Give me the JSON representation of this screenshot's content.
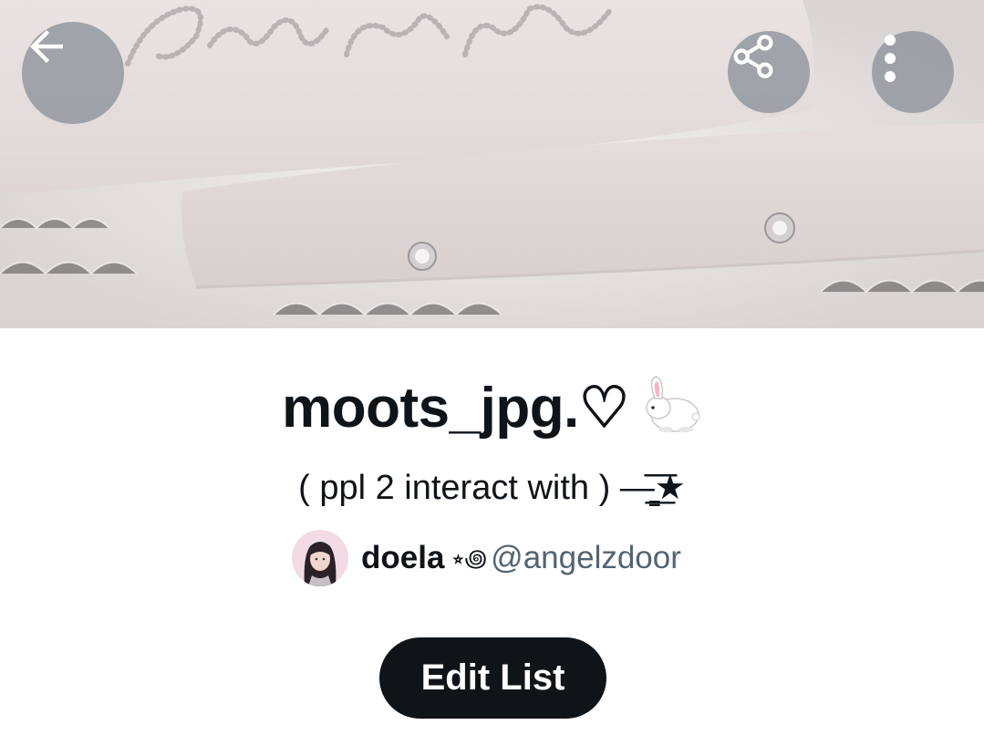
{
  "header": {
    "back_icon": "arrow-left-icon",
    "share_icon": "share-icon",
    "more_icon": "more-vertical-icon"
  },
  "list": {
    "title": "moots_jpg.♡",
    "title_emoji": "rabbit",
    "description": "( ppl 2 interact with ) —̳͟͞͞★",
    "owner": {
      "name": "doela",
      "name_emoji": "⭒꩜",
      "handle": "@angelzdoor"
    }
  },
  "actions": {
    "edit_label": "Edit List"
  },
  "colors": {
    "text_primary": "#0f1419",
    "text_secondary": "#536471",
    "button_bg": "#0f1419",
    "overlay_button": "#8c929a"
  }
}
